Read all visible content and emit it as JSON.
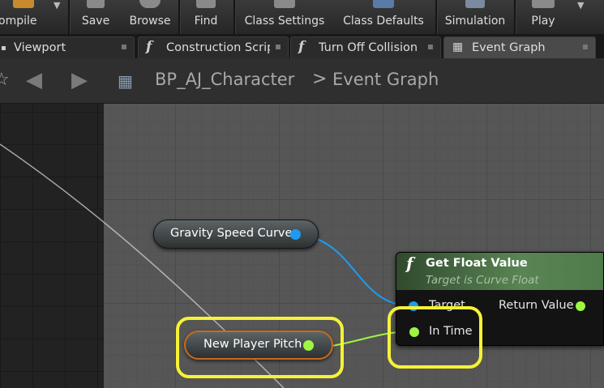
{
  "toolbar": {
    "buttons": [
      {
        "label": "ompile",
        "icon": "compile-icon"
      },
      {
        "label": "Save",
        "icon": "save-icon"
      },
      {
        "label": "Browse",
        "icon": "browse-icon"
      },
      {
        "label": "Find",
        "icon": "find-icon"
      },
      {
        "label": "Class Settings",
        "icon": "class-settings-icon"
      },
      {
        "label": "Class Defaults",
        "icon": "class-defaults-icon"
      },
      {
        "label": "Simulation",
        "icon": "simulation-icon"
      },
      {
        "label": "Play",
        "icon": "play-icon"
      }
    ]
  },
  "tabs": [
    {
      "label": "Viewport",
      "icon": "viewport-icon"
    },
    {
      "label": "Construction Scrip",
      "icon": "function-icon"
    },
    {
      "label": "Turn Off Collision",
      "icon": "function-icon"
    },
    {
      "label": "Event Graph",
      "icon": "event-graph-icon",
      "active": true
    }
  ],
  "breadcrumb": {
    "root": "BP_AJ_Character",
    "separator": ">",
    "page": "Event Graph"
  },
  "graph": {
    "nodes": {
      "gravity_speed_curve": {
        "label": "Gravity Speed Curve",
        "pin_color": "#1e9bf0"
      },
      "new_player_pitch": {
        "label": "New Player Pitch",
        "pin_color": "#9ef542",
        "highlighted": true
      },
      "get_float_value": {
        "icon": "f",
        "title": "Get Float Value",
        "subtitle": "Target is Curve Float",
        "inputs": [
          {
            "label": "Target",
            "color": "#1e9bf0"
          },
          {
            "label": "In Time",
            "color": "#9ef542",
            "highlighted": true
          }
        ],
        "outputs": [
          {
            "label": "Return Value",
            "color": "#9ef542"
          }
        ]
      }
    },
    "highlight_color": "#f7f235"
  },
  "colors": {
    "object_pin": "#1e9bf0",
    "float_pin": "#9ef542",
    "function_header": "#5a8454"
  }
}
